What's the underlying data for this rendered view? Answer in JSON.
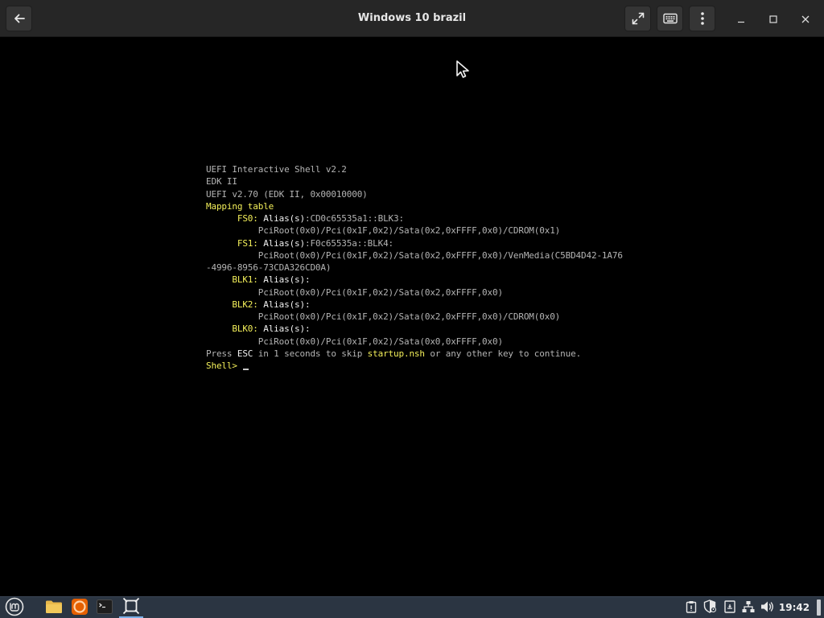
{
  "window": {
    "title": "Windows 10 brazil"
  },
  "titlebar_icons": {
    "back": "arrow-left-icon",
    "fullscreen": "fullscreen-icon",
    "keyboard": "keyboard-icon",
    "menu": "kebab-menu-icon",
    "minimize": "minimize-icon",
    "maximize": "maximize-icon",
    "close": "close-icon"
  },
  "shell": {
    "lines": [
      {
        "segments": [
          {
            "text": "UEFI Interactive Shell v2.2",
            "color": "gray"
          }
        ]
      },
      {
        "segments": [
          {
            "text": "EDK II",
            "color": "gray"
          }
        ]
      },
      {
        "segments": [
          {
            "text": "UEFI v2.70 (EDK II, 0x00010000)",
            "color": "gray"
          }
        ]
      },
      {
        "segments": [
          {
            "text": "Mapping table",
            "color": "yellow"
          }
        ]
      },
      {
        "segments": [
          {
            "text": "      ",
            "color": "gray"
          },
          {
            "text": "FS0:",
            "color": "yellow"
          },
          {
            "text": " Alias(s)",
            "color": "white"
          },
          {
            "text": ":CD0c65535a1::BLK3:",
            "color": "gray"
          }
        ]
      },
      {
        "segments": [
          {
            "text": "          PciRoot(0x0)/Pci(0x1F,0x2)/Sata(0x2,0xFFFF,0x0)/CDROM(0x1)",
            "color": "gray"
          }
        ]
      },
      {
        "segments": [
          {
            "text": "      ",
            "color": "gray"
          },
          {
            "text": "FS1:",
            "color": "yellow"
          },
          {
            "text": " Alias(s)",
            "color": "white"
          },
          {
            "text": ":F0c65535a::BLK4:",
            "color": "gray"
          }
        ]
      },
      {
        "segments": [
          {
            "text": "          PciRoot(0x0)/Pci(0x1F,0x2)/Sata(0x2,0xFFFF,0x0)/VenMedia(C5BD4D42-1A76",
            "color": "gray"
          }
        ]
      },
      {
        "segments": [
          {
            "text": "-4996-8956-73CDA326CD0A)",
            "color": "gray"
          }
        ]
      },
      {
        "segments": [
          {
            "text": "     ",
            "color": "gray"
          },
          {
            "text": "BLK1:",
            "color": "yellow"
          },
          {
            "text": " Alias(s):",
            "color": "white"
          }
        ]
      },
      {
        "segments": [
          {
            "text": "          PciRoot(0x0)/Pci(0x1F,0x2)/Sata(0x2,0xFFFF,0x0)",
            "color": "gray"
          }
        ]
      },
      {
        "segments": [
          {
            "text": "     ",
            "color": "gray"
          },
          {
            "text": "BLK2:",
            "color": "yellow"
          },
          {
            "text": " Alias(s):",
            "color": "white"
          }
        ]
      },
      {
        "segments": [
          {
            "text": "          PciRoot(0x0)/Pci(0x1F,0x2)/Sata(0x2,0xFFFF,0x0)/CDROM(0x0)",
            "color": "gray"
          }
        ]
      },
      {
        "segments": [
          {
            "text": "     ",
            "color": "gray"
          },
          {
            "text": "BLK0:",
            "color": "yellow"
          },
          {
            "text": " Alias(s):",
            "color": "white"
          }
        ]
      },
      {
        "segments": [
          {
            "text": "          PciRoot(0x0)/Pci(0x1F,0x2)/Sata(0x0,0xFFFF,0x0)",
            "color": "gray"
          }
        ]
      },
      {
        "segments": [
          {
            "text": "Press ",
            "color": "gray"
          },
          {
            "text": "ESC",
            "color": "white"
          },
          {
            "text": " in 1 seconds to skip ",
            "color": "gray"
          },
          {
            "text": "startup.nsh",
            "color": "yellow"
          },
          {
            "text": " or any other key to continue.",
            "color": "gray"
          }
        ]
      }
    ],
    "prompt": "Shell>"
  },
  "taskbar": {
    "apps": [
      {
        "name": "mint-menu-icon"
      },
      {
        "name": "file-manager-icon"
      },
      {
        "name": "firefox-icon"
      },
      {
        "name": "terminal-icon"
      },
      {
        "name": "virt-manager-icon"
      }
    ],
    "tray": [
      {
        "name": "clipboard-icon"
      },
      {
        "name": "update-shield-icon"
      },
      {
        "name": "notes-icon"
      },
      {
        "name": "network-icon"
      },
      {
        "name": "volume-icon"
      }
    ],
    "clock": "19:42"
  },
  "colors": {
    "titlebar_bg": "#262626",
    "display_bg": "#000000",
    "taskbar_bg": "#2b3542",
    "shell_gray": "#b4b4b4",
    "shell_yellow": "#f4f05a",
    "shell_white": "#f0f0f0",
    "firefox_orange": "#e66000",
    "folder_yellow": "#e8b84a",
    "mint_green": "#86be43"
  }
}
